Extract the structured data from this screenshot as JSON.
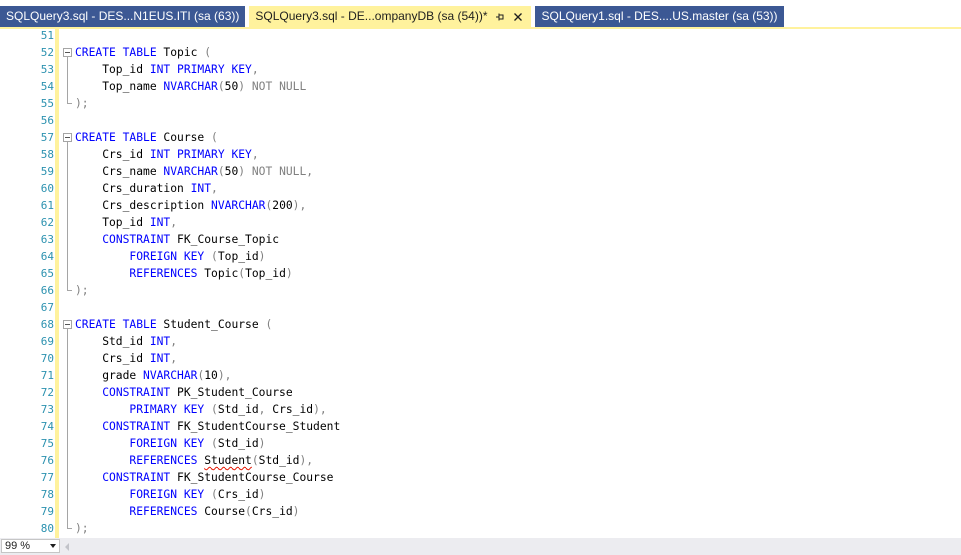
{
  "tabs": [
    {
      "label": "SQLQuery3.sql - DES...N1EUS.ITI (sa (63))",
      "active": false
    },
    {
      "label": "SQLQuery3.sql - DE...ompanyDB (sa (54))*",
      "active": true,
      "pin_icon": "pin-icon",
      "close_icon": "close-icon"
    },
    {
      "label": "SQLQuery1.sql - DES....US.master (sa (53))",
      "active": false
    }
  ],
  "editor": {
    "line_numbers": [
      "51",
      "52",
      "53",
      "54",
      "55",
      "56",
      "57",
      "58",
      "59",
      "60",
      "61",
      "62",
      "63",
      "64",
      "65",
      "66",
      "67",
      "68",
      "69",
      "70",
      "71",
      "72",
      "73",
      "74",
      "75",
      "76",
      "77",
      "78",
      "79",
      "80"
    ],
    "lines": [
      [],
      [
        {
          "t": "CREATE TABLE",
          "c": "kw"
        },
        {
          "t": " Topic "
        },
        {
          "t": "(",
          "c": "gr"
        }
      ],
      [
        {
          "t": "    Top_id "
        },
        {
          "t": "INT PRIMARY KEY",
          "c": "kw"
        },
        {
          "t": ",",
          "c": "gr"
        }
      ],
      [
        {
          "t": "    Top_name "
        },
        {
          "t": "NVARCHAR",
          "c": "kw"
        },
        {
          "t": "(",
          "c": "gr"
        },
        {
          "t": "50"
        },
        {
          "t": ") NOT NULL",
          "c": "gr"
        }
      ],
      [
        {
          "t": ");",
          "c": "gr"
        }
      ],
      [],
      [
        {
          "t": "CREATE TABLE",
          "c": "kw"
        },
        {
          "t": " Course "
        },
        {
          "t": "(",
          "c": "gr"
        }
      ],
      [
        {
          "t": "    Crs_id "
        },
        {
          "t": "INT PRIMARY KEY",
          "c": "kw"
        },
        {
          "t": ",",
          "c": "gr"
        }
      ],
      [
        {
          "t": "    Crs_name "
        },
        {
          "t": "NVARCHAR",
          "c": "kw"
        },
        {
          "t": "(",
          "c": "gr"
        },
        {
          "t": "50"
        },
        {
          "t": ") NOT NULL,",
          "c": "gr"
        }
      ],
      [
        {
          "t": "    Crs_duration "
        },
        {
          "t": "INT",
          "c": "kw"
        },
        {
          "t": ",",
          "c": "gr"
        }
      ],
      [
        {
          "t": "    Crs_description "
        },
        {
          "t": "NVARCHAR",
          "c": "kw"
        },
        {
          "t": "(",
          "c": "gr"
        },
        {
          "t": "200"
        },
        {
          "t": "),",
          "c": "gr"
        }
      ],
      [
        {
          "t": "    Top_id "
        },
        {
          "t": "INT",
          "c": "kw"
        },
        {
          "t": ",",
          "c": "gr"
        }
      ],
      [
        {
          "t": "    "
        },
        {
          "t": "CONSTRAINT",
          "c": "kw"
        },
        {
          "t": " FK_Course_Topic"
        }
      ],
      [
        {
          "t": "        "
        },
        {
          "t": "FOREIGN KEY",
          "c": "kw"
        },
        {
          "t": " (",
          "c": "gr"
        },
        {
          "t": "Top_id"
        },
        {
          "t": ")",
          "c": "gr"
        }
      ],
      [
        {
          "t": "        "
        },
        {
          "t": "REFERENCES",
          "c": "kw"
        },
        {
          "t": " Topic"
        },
        {
          "t": "(",
          "c": "gr"
        },
        {
          "t": "Top_id"
        },
        {
          "t": ")",
          "c": "gr"
        }
      ],
      [
        {
          "t": ");",
          "c": "gr"
        }
      ],
      [],
      [
        {
          "t": "CREATE TABLE",
          "c": "kw"
        },
        {
          "t": " Student_Course "
        },
        {
          "t": "(",
          "c": "gr"
        }
      ],
      [
        {
          "t": "    Std_id "
        },
        {
          "t": "INT",
          "c": "kw"
        },
        {
          "t": ",",
          "c": "gr"
        }
      ],
      [
        {
          "t": "    Crs_id "
        },
        {
          "t": "INT",
          "c": "kw"
        },
        {
          "t": ",",
          "c": "gr"
        }
      ],
      [
        {
          "t": "    grade "
        },
        {
          "t": "NVARCHAR",
          "c": "kw"
        },
        {
          "t": "(",
          "c": "gr"
        },
        {
          "t": "10"
        },
        {
          "t": "),",
          "c": "gr"
        }
      ],
      [
        {
          "t": "    "
        },
        {
          "t": "CONSTRAINT",
          "c": "kw"
        },
        {
          "t": " PK_Student_Course"
        }
      ],
      [
        {
          "t": "        "
        },
        {
          "t": "PRIMARY KEY",
          "c": "kw"
        },
        {
          "t": " (",
          "c": "gr"
        },
        {
          "t": "Std_id"
        },
        {
          "t": ", ",
          "c": "gr"
        },
        {
          "t": "Crs_id"
        },
        {
          "t": "),",
          "c": "gr"
        }
      ],
      [
        {
          "t": "    "
        },
        {
          "t": "CONSTRAINT",
          "c": "kw"
        },
        {
          "t": " FK_StudentCourse_Student"
        }
      ],
      [
        {
          "t": "        "
        },
        {
          "t": "FOREIGN KEY",
          "c": "kw"
        },
        {
          "t": " (",
          "c": "gr"
        },
        {
          "t": "Std_id"
        },
        {
          "t": ")",
          "c": "gr"
        }
      ],
      [
        {
          "t": "        "
        },
        {
          "t": "REFERENCES",
          "c": "kw"
        },
        {
          "t": " "
        },
        {
          "t": "Student",
          "c": "sq"
        },
        {
          "t": "(",
          "c": "gr"
        },
        {
          "t": "Std_id"
        },
        {
          "t": "),",
          "c": "gr"
        }
      ],
      [
        {
          "t": "    "
        },
        {
          "t": "CONSTRAINT",
          "c": "kw"
        },
        {
          "t": " FK_StudentCourse_Course"
        }
      ],
      [
        {
          "t": "        "
        },
        {
          "t": "FOREIGN KEY",
          "c": "kw"
        },
        {
          "t": " (",
          "c": "gr"
        },
        {
          "t": "Crs_id"
        },
        {
          "t": ")",
          "c": "gr"
        }
      ],
      [
        {
          "t": "        "
        },
        {
          "t": "REFERENCES",
          "c": "kw"
        },
        {
          "t": " Course"
        },
        {
          "t": "(",
          "c": "gr"
        },
        {
          "t": "Crs_id"
        },
        {
          "t": ")",
          "c": "gr"
        }
      ],
      [
        {
          "t": ");",
          "c": "gr"
        }
      ]
    ]
  },
  "status": {
    "zoom_value": "99 %",
    "zoom_icon": "chevron-down-icon",
    "scroll_icon": "scroll-left-icon"
  },
  "colors": {
    "tab_inactive_bg": "#3c5894",
    "tab_active_bg": "#fff29d",
    "keyword": "#0000ff",
    "punctuation": "#808080",
    "line_number": "#2b91af",
    "error_squiggle": "#e51400"
  }
}
